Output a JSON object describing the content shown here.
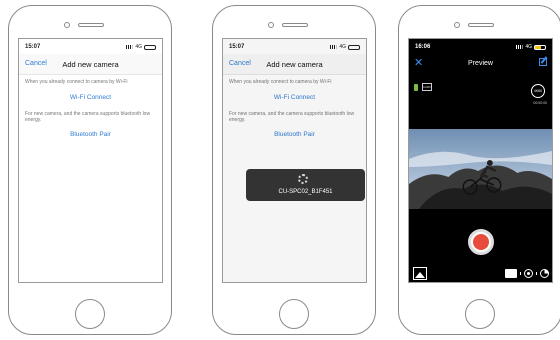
{
  "phone1": {
    "status_time": "15:07",
    "status_network": "4G",
    "nav": {
      "cancel": "Cancel",
      "title": "Add new camera"
    },
    "wifi_text": "When you already connect to camera by Wi-Fi",
    "wifi_link": "Wi-Fi Connect",
    "bt_text": "For new camera, and the camera supports bluetooth low energy.",
    "bt_link": "Bluetooth Pair"
  },
  "phone2": {
    "status_time": "15:07",
    "status_network": "4G",
    "nav": {
      "cancel": "Cancel",
      "title": "Add new camera"
    },
    "wifi_text": "When you already connect to camera by Wi-Fi",
    "wifi_link": "Wi-Fi Connect",
    "bt_text": "For new camera, and the camera supports bluetooth low energy.",
    "bt_link": "Bluetooth Pair",
    "toast": {
      "text": "CU-SPC02_B1F451"
    }
  },
  "phone3": {
    "status_time": "16:06",
    "status_network": "4G",
    "header": {
      "title": "Preview"
    },
    "sd_label": "CARD",
    "resolution_badge": "4K60",
    "duration": "00:00:00"
  },
  "colors": {
    "accent": "#2e7bd3",
    "record": "#e74c3c",
    "battery": "#7ac043"
  }
}
